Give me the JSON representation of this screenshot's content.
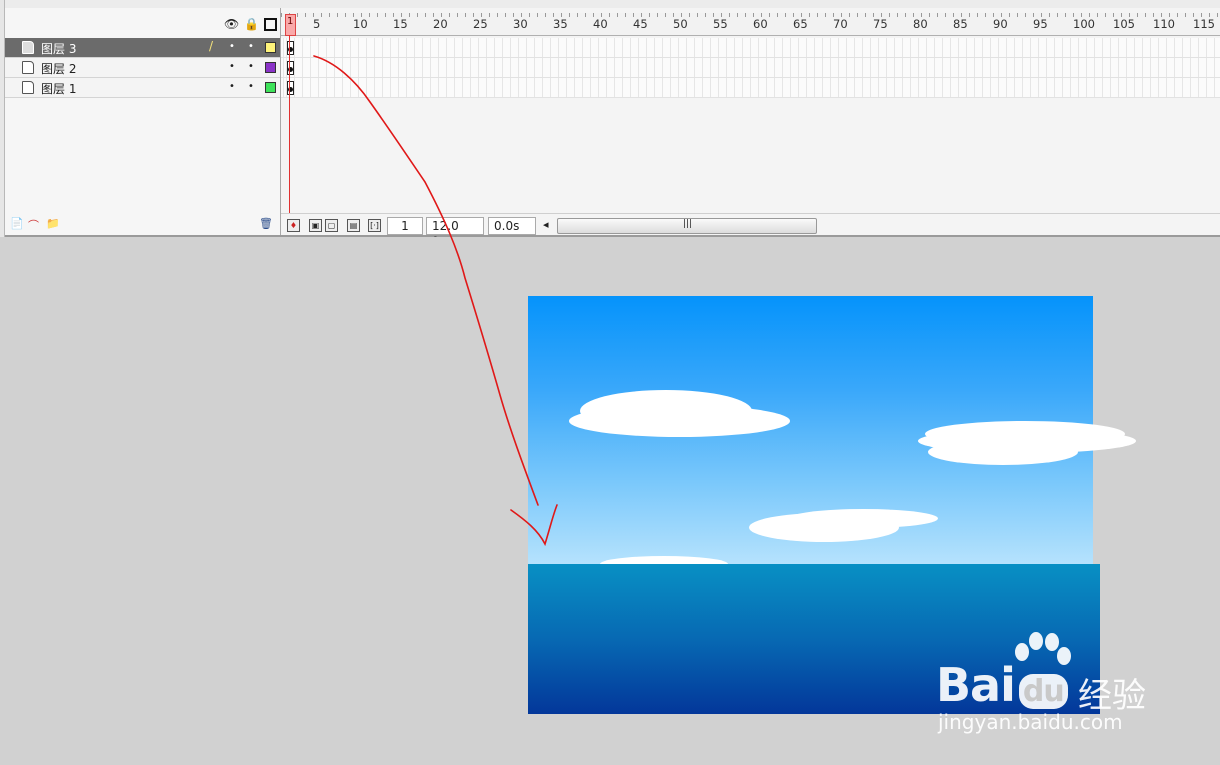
{
  "timeline": {
    "layers": [
      {
        "name": "图层 3",
        "color": "#fff47a",
        "selected": true
      },
      {
        "name": "图层 2",
        "color": "#8a33c8",
        "selected": false
      },
      {
        "name": "图层 1",
        "color": "#3ee25a",
        "selected": false
      }
    ],
    "ruler_labels": [
      "1",
      "5",
      "10",
      "15",
      "20",
      "25",
      "30",
      "35",
      "40",
      "45",
      "50",
      "55",
      "60",
      "65",
      "70",
      "75",
      "80",
      "85",
      "90",
      "95",
      "100",
      "105",
      "110",
      "115"
    ],
    "current_frame": "1",
    "fps": "12.0 fps",
    "elapsed": "0.0s",
    "header_icons": [
      "eye-icon",
      "lock-icon",
      "outline-icon"
    ]
  },
  "stage": {
    "sky_colors": [
      "#0593fb",
      "#b7e3fd"
    ],
    "sea_colors": [
      "#0890c4",
      "#03379a"
    ]
  },
  "watermark": {
    "brand": "Bai",
    "brand_du": "du",
    "cn": "经验",
    "url": "jingyan.baidu.com"
  }
}
